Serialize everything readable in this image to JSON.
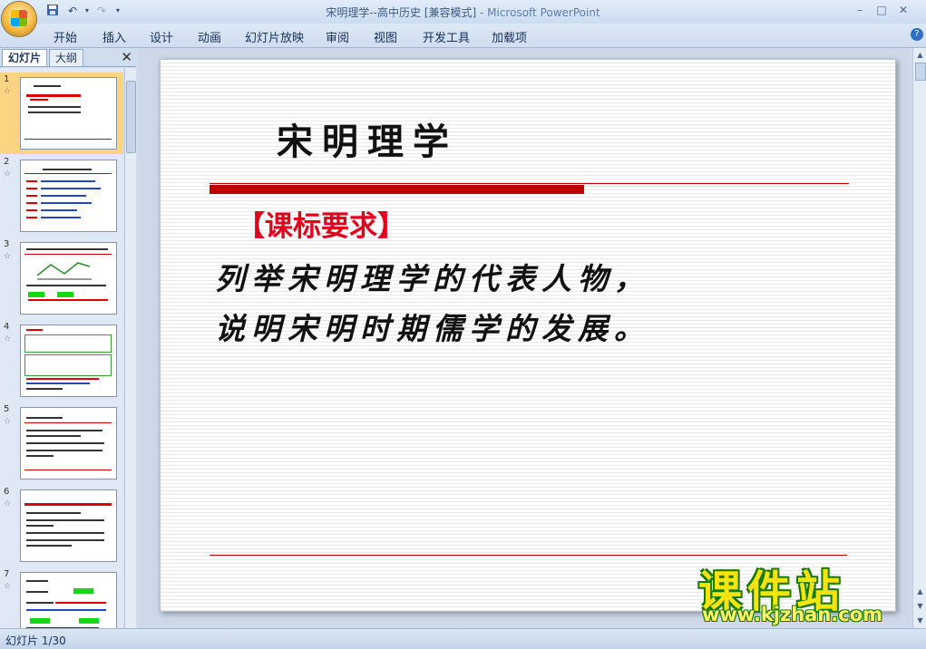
{
  "window": {
    "title": "宋明理学--高中历史 [兼容模式]",
    "app_suffix": " - Microsoft PowerPoint"
  },
  "quick_access": {
    "icons": [
      "save-icon",
      "undo-icon",
      "redo-icon",
      "customize-icon"
    ]
  },
  "ribbon": {
    "tabs": [
      "开始",
      "插入",
      "设计",
      "动画",
      "幻灯片放映",
      "审阅",
      "视图",
      "开发工具",
      "加载项"
    ]
  },
  "left_panel": {
    "tabs": [
      "幻灯片",
      "大纲"
    ],
    "active_tab": "幻灯片",
    "thumbnails": [
      {
        "number": "1"
      },
      {
        "number": "2"
      },
      {
        "number": "3"
      },
      {
        "number": "4"
      },
      {
        "number": "5"
      },
      {
        "number": "6"
      },
      {
        "number": "7"
      }
    ],
    "selected": 1
  },
  "slide": {
    "title": "宋明理学",
    "subtitle": "【课标要求】",
    "lines": [
      "列举宋明理学的代表人物，",
      "说明宋明时期儒学的发展。"
    ]
  },
  "status": {
    "text": "幻灯片 1/30"
  },
  "watermark": {
    "text": "课件站",
    "url": "www.kjzhan.com"
  },
  "colors": {
    "accent_red": "#c00000",
    "subtitle_red": "#e0001b",
    "selected_thumb": "#fbd582"
  }
}
